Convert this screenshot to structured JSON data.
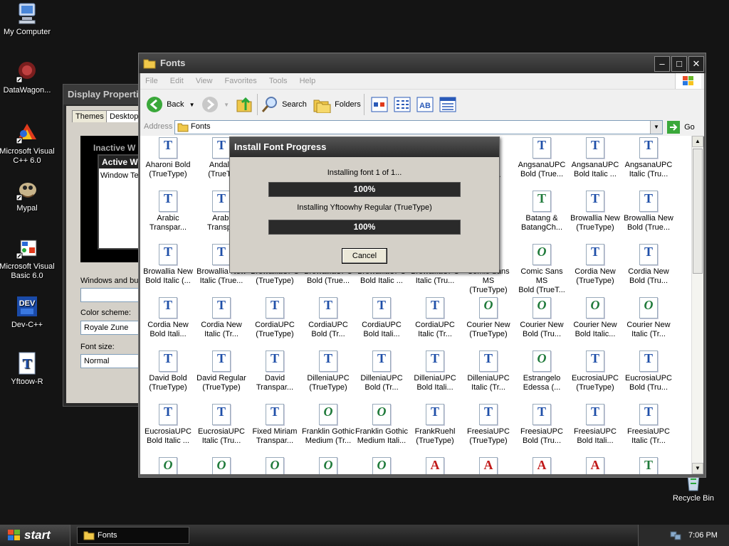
{
  "desktop": {
    "icons": [
      {
        "label": "My Computer"
      },
      {
        "label": "DataWagon..."
      },
      {
        "label": "Microsoft Visual C++ 6.0"
      },
      {
        "label": "Mypal"
      },
      {
        "label": "Microsoft Visual Basic 6.0"
      },
      {
        "label": "Dev-C++"
      },
      {
        "label": "Yftoow-R"
      },
      {
        "label": "Recycle Bin"
      }
    ]
  },
  "display_properties": {
    "title": "Display Properti",
    "tabs": [
      "Themes",
      "Desktop"
    ],
    "preview_inactive": "Inactive W",
    "preview_active": "Active W",
    "preview_text": "Window Te",
    "windows_buttons_label": "Windows and bu",
    "color_scheme_label": "Color scheme:",
    "color_scheme_value": "Royale Zune",
    "font_size_label": "Font size:",
    "font_size_value": "Normal"
  },
  "fonts_window": {
    "title": "Fonts",
    "menu": [
      "File",
      "Edit",
      "View",
      "Favorites",
      "Tools",
      "Help"
    ],
    "toolbar": {
      "back": "Back",
      "search": "Search",
      "folders": "Folders"
    },
    "address_label": "Address",
    "address_value": "Fonts",
    "go_label": "Go",
    "items": [
      {
        "l1": "Aharoni Bold",
        "l2": "(TrueType)",
        "icon": "T"
      },
      {
        "l1": "Andalu",
        "l2": "(TrueTy",
        "icon": "T"
      },
      {
        "l1": "",
        "l2": "",
        "icon": ""
      },
      {
        "l1": "",
        "l2": "",
        "icon": ""
      },
      {
        "l1": "",
        "l2": "",
        "icon": ""
      },
      {
        "l1": "",
        "l2": "",
        "icon": ""
      },
      {
        "l1": "UPC",
        "l2": "(True...",
        "icon": ""
      },
      {
        "l1": "AngsanaUPC",
        "l2": "Bold (True...",
        "icon": "T"
      },
      {
        "l1": "AngsanaUPC",
        "l2": "Bold Italic ...",
        "icon": "T"
      },
      {
        "l1": "AngsanaUPC",
        "l2": "Italic (Tru...",
        "icon": "T"
      },
      {
        "l1": "Arabic",
        "l2": "Transpar...",
        "icon": "T"
      },
      {
        "l1": "Arabi",
        "l2": "Transpa",
        "icon": "T"
      },
      {
        "l1": "",
        "l2": "",
        "icon": ""
      },
      {
        "l1": "",
        "l2": "",
        "icon": ""
      },
      {
        "l1": "",
        "l2": "",
        "icon": ""
      },
      {
        "l1": "",
        "l2": "",
        "icon": ""
      },
      {
        "l1": "c",
        "l2": "e)",
        "icon": ""
      },
      {
        "l1": "Batang &",
        "l2": "BatangCh...",
        "icon": "Tg"
      },
      {
        "l1": "Browallia New",
        "l2": "(TrueType)",
        "icon": "T"
      },
      {
        "l1": "Browallia New",
        "l2": "Bold (True...",
        "icon": "T"
      },
      {
        "l1": "Browallia New",
        "l2": "Bold Italic (...",
        "icon": "T"
      },
      {
        "l1": "Browallia New",
        "l2": "Italic (True...",
        "icon": "T"
      },
      {
        "l1": "BrowalliaUPC",
        "l2": "(TrueType)",
        "icon": "T"
      },
      {
        "l1": "BrowalliaUPC",
        "l2": "Bold (True...",
        "icon": "T"
      },
      {
        "l1": "BrowalliaUPC",
        "l2": "Bold Italic ...",
        "icon": "T"
      },
      {
        "l1": "BrowalliaUPC",
        "l2": "Italic (Tru...",
        "icon": "T"
      },
      {
        "l1": "Comic Sans MS",
        "l2": "(TrueType)",
        "icon": "O"
      },
      {
        "l1": "Comic Sans MS",
        "l2": "Bold (TrueT...",
        "icon": "O"
      },
      {
        "l1": "Cordia New",
        "l2": "(TrueType)",
        "icon": "T"
      },
      {
        "l1": "Cordia New",
        "l2": "Bold (Tru...",
        "icon": "T"
      },
      {
        "l1": "Cordia New",
        "l2": "Bold Itali...",
        "icon": "T"
      },
      {
        "l1": "Cordia New",
        "l2": "Italic (Tr...",
        "icon": "T"
      },
      {
        "l1": "CordiaUPC",
        "l2": "(TrueType)",
        "icon": "T"
      },
      {
        "l1": "CordiaUPC",
        "l2": "Bold (Tr...",
        "icon": "T"
      },
      {
        "l1": "CordiaUPC",
        "l2": "Bold Itali...",
        "icon": "T"
      },
      {
        "l1": "CordiaUPC",
        "l2": "Italic (Tr...",
        "icon": "T"
      },
      {
        "l1": "Courier New",
        "l2": "(TrueType)",
        "icon": "O"
      },
      {
        "l1": "Courier New",
        "l2": "Bold (Tru...",
        "icon": "O"
      },
      {
        "l1": "Courier New",
        "l2": "Bold Italic...",
        "icon": "O"
      },
      {
        "l1": "Courier New",
        "l2": "Italic (Tr...",
        "icon": "O"
      },
      {
        "l1": "David Bold",
        "l2": "(TrueType)",
        "icon": "T"
      },
      {
        "l1": "David Regular",
        "l2": "(TrueType)",
        "icon": "T"
      },
      {
        "l1": "David",
        "l2": "Transpar...",
        "icon": "T"
      },
      {
        "l1": "DilleniaUPC",
        "l2": "(TrueType)",
        "icon": "T"
      },
      {
        "l1": "DilleniaUPC",
        "l2": "Bold (Tr...",
        "icon": "T"
      },
      {
        "l1": "DilleniaUPC",
        "l2": "Bold Itali...",
        "icon": "T"
      },
      {
        "l1": "DilleniaUPC",
        "l2": "Italic (Tr...",
        "icon": "T"
      },
      {
        "l1": "Estrangelo",
        "l2": "Edessa (...",
        "icon": "O"
      },
      {
        "l1": "EucrosiaUPC",
        "l2": "(TrueType)",
        "icon": "T"
      },
      {
        "l1": "EucrosiaUPC",
        "l2": "Bold (Tru...",
        "icon": "T"
      },
      {
        "l1": "EucrosiaUPC",
        "l2": "Bold Italic ...",
        "icon": "T"
      },
      {
        "l1": "EucrosiaUPC",
        "l2": "Italic (Tru...",
        "icon": "T"
      },
      {
        "l1": "Fixed Miriam",
        "l2": "Transpar...",
        "icon": "T"
      },
      {
        "l1": "Franklin Gothic",
        "l2": "Medium (Tr...",
        "icon": "O"
      },
      {
        "l1": "Franklin Gothic",
        "l2": "Medium Itali...",
        "icon": "O"
      },
      {
        "l1": "FrankRuehl",
        "l2": "(TrueType)",
        "icon": "T"
      },
      {
        "l1": "FreesiaUPC",
        "l2": "(TrueType)",
        "icon": "T"
      },
      {
        "l1": "FreesiaUPC",
        "l2": "Bold (Tru...",
        "icon": "T"
      },
      {
        "l1": "FreesiaUPC",
        "l2": "Bold Itali...",
        "icon": "T"
      },
      {
        "l1": "FreesiaUPC",
        "l2": "Italic (Tr...",
        "icon": "T"
      },
      {
        "l1": "",
        "l2": "",
        "icon": "O"
      },
      {
        "l1": "",
        "l2": "",
        "icon": "O"
      },
      {
        "l1": "",
        "l2": "",
        "icon": "O"
      },
      {
        "l1": "",
        "l2": "",
        "icon": "O"
      },
      {
        "l1": "",
        "l2": "",
        "icon": "O"
      },
      {
        "l1": "",
        "l2": "",
        "icon": "A"
      },
      {
        "l1": "",
        "l2": "",
        "icon": "A"
      },
      {
        "l1": "",
        "l2": "",
        "icon": "A"
      },
      {
        "l1": "",
        "l2": "",
        "icon": "A"
      },
      {
        "l1": "",
        "l2": "",
        "icon": "Tg"
      }
    ]
  },
  "install_dialog": {
    "title": "Install Font Progress",
    "status_line": "Installing font 1 of 1...",
    "overall_progress": 1.0,
    "overall_label": "100%",
    "current_line": "Installing Yftoowhy Regular (TrueType)",
    "current_progress": 1.0,
    "current_label": "100%",
    "cancel_label": "Cancel"
  },
  "taskbar": {
    "start_label": "start",
    "task_label": "Fonts",
    "clock": "7:06 PM"
  },
  "colors": {
    "desktop": "#141414",
    "truetype_icon": "#1f4fa8",
    "opentype_icon": "#1f7a3a",
    "raster_icon": "#c01818"
  }
}
